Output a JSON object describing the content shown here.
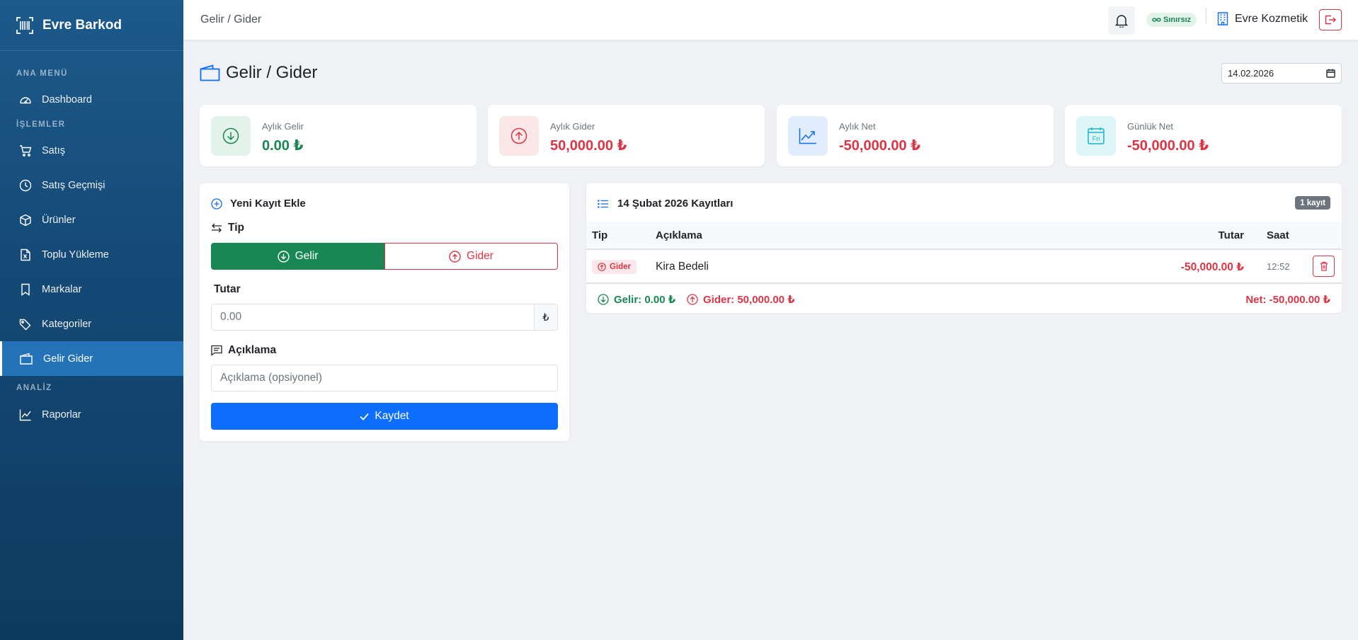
{
  "colors": {
    "income": "#198754",
    "expense": "#dc3545",
    "primary": "#0d6efd",
    "sidebar": "#154a77"
  },
  "sidebar": {
    "brand": "Evre Barkod",
    "sections": {
      "main": "ANA MENÜ",
      "ops": "İŞLEMLER",
      "analysis": "ANALİZ"
    },
    "items": [
      {
        "label": "Dashboard",
        "icon": "speedometer-icon"
      },
      {
        "label": "Satış",
        "icon": "cart-icon"
      },
      {
        "label": "Satış Geçmişi",
        "icon": "clock-icon"
      },
      {
        "label": "Ürünler",
        "icon": "box-icon"
      },
      {
        "label": "Toplu Yükleme",
        "icon": "excel-file-icon"
      },
      {
        "label": "Markalar",
        "icon": "bookmark-icon"
      },
      {
        "label": "Kategoriler",
        "icon": "tags-icon"
      },
      {
        "label": "Gelir Gider",
        "icon": "wallet-icon",
        "active": true
      },
      {
        "label": "Raporlar",
        "icon": "graph-up-icon"
      }
    ]
  },
  "topbar": {
    "breadcrumb": "Gelir / Gider",
    "plan_badge": "Sınırsız",
    "company": "Evre Kozmetik"
  },
  "page": {
    "title": "Gelir / Gider",
    "date": "14.02.2026"
  },
  "stats": [
    {
      "label": "Aylık Gelir",
      "value": "0.00 ₺",
      "icon": "arrow-down-circle-icon"
    },
    {
      "label": "Aylık Gider",
      "value": "50,000.00 ₺",
      "icon": "arrow-up-circle-icon"
    },
    {
      "label": "Aylık Net",
      "value": "-50,000.00 ₺",
      "icon": "graph-up-arrow-icon"
    },
    {
      "label": "Günlük Net",
      "value": "-50,000.00 ₺",
      "icon": "calendar-day-icon",
      "icon_text": "Fri"
    }
  ],
  "form": {
    "title": "Yeni Kayıt Ekle",
    "type_label": "Tip",
    "income_btn": "Gelir",
    "expense_btn": "Gider",
    "amount_label": "Tutar",
    "amount_placeholder": "0.00",
    "currency": "₺",
    "desc_label": "Açıklama",
    "desc_placeholder": "Açıklama (opsiyonel)",
    "save_btn": "Kaydet"
  },
  "records": {
    "title": "14 Şubat 2026 Kayıtları",
    "count": "1 kayıt",
    "headers": {
      "type": "Tip",
      "desc": "Açıklama",
      "amount": "Tutar",
      "time": "Saat"
    },
    "rows": [
      {
        "type": "Gider",
        "desc": "Kira Bedeli",
        "amount": "-50,000.00 ₺",
        "time": "12:52"
      }
    ],
    "footer": {
      "income": "Gelir: 0.00 ₺",
      "expense": "Gider: 50,000.00 ₺",
      "net": "Net: -50,000.00 ₺"
    }
  }
}
